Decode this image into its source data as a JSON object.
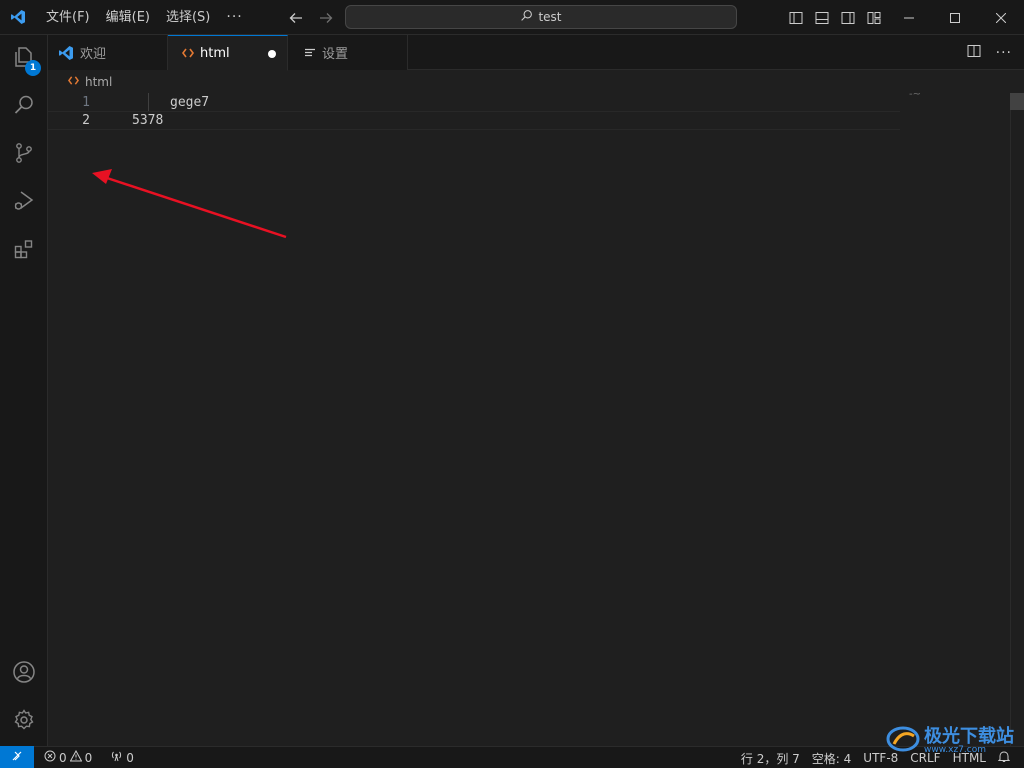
{
  "menu": {
    "file": "文件(F)",
    "edit": "编辑(E)",
    "selection": "选择(S)",
    "more": "···"
  },
  "command_center": {
    "text": "test"
  },
  "activity": {
    "explorer_badge": "1"
  },
  "tabs": [
    {
      "label": "欢迎",
      "icon": "vscode-logo-icon"
    },
    {
      "label": "html",
      "icon": "html-file-icon",
      "dirty": true
    },
    {
      "label": "设置",
      "icon": "settings-list-icon"
    }
  ],
  "breadcrumb": {
    "file": "html"
  },
  "editor": {
    "lines": [
      {
        "number": "1",
        "text": "gege7"
      },
      {
        "number": "2",
        "text": "5378"
      }
    ],
    "minimap_text": "-~"
  },
  "status": {
    "errors": "0",
    "warnings": "0",
    "ports": "0",
    "cursor": "行 2，列 7",
    "indent": "空格: 4",
    "encoding": "UTF-8",
    "eol": "CRLF",
    "language": "HTML"
  },
  "watermark": {
    "text": "极光下载站",
    "url": "www.xz7.com"
  },
  "colors": {
    "accent": "#0078d4",
    "annotation_arrow": "#e81123",
    "html_icon": "#e37933"
  }
}
